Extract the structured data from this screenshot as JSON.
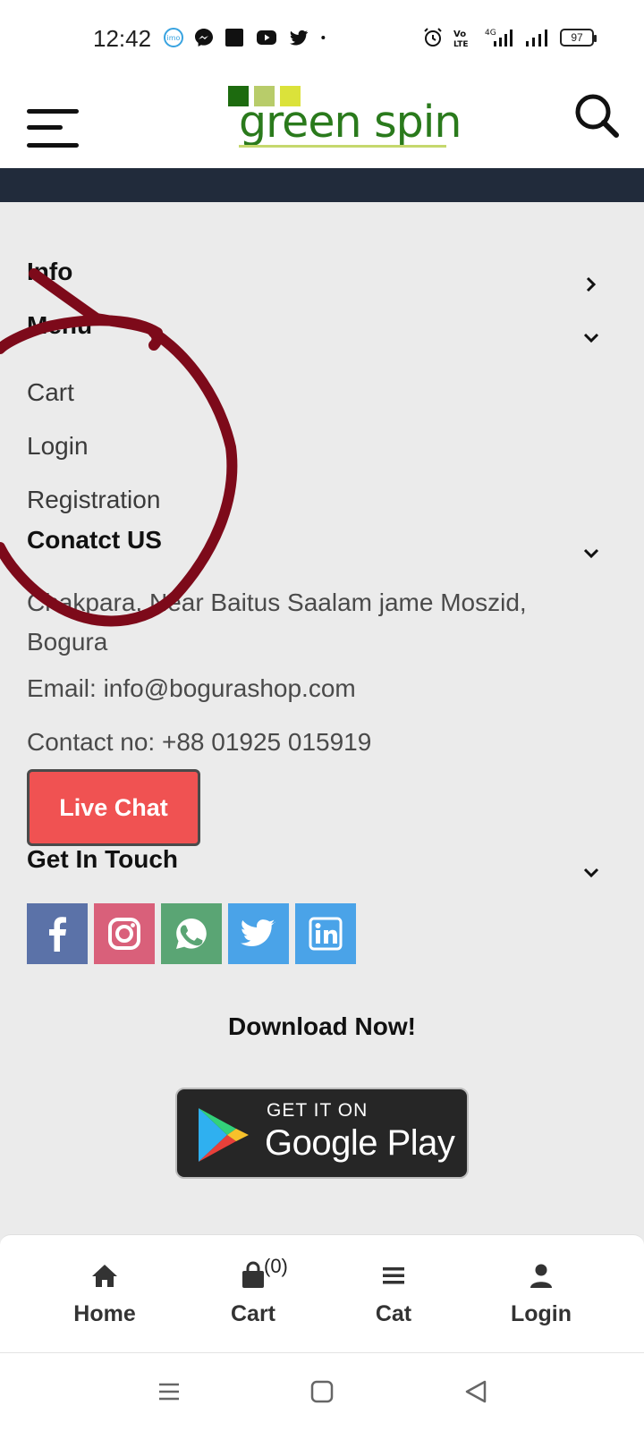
{
  "status_bar": {
    "time": "12:42",
    "battery": "97",
    "icons_left": [
      "imo-icon",
      "messenger-icon",
      "app-square-icon",
      "youtube-icon",
      "twitter-icon",
      "dot-icon"
    ],
    "icons_right": [
      "alarm-icon",
      "volte-icon",
      "signal-4g-icon",
      "signal-icon",
      "battery-icon"
    ]
  },
  "header": {
    "logo_text": "green spin",
    "logo_colors": [
      "#1d6b0f",
      "#b8cc6a",
      "#dbe23a"
    ]
  },
  "footer": {
    "info_title": "Info",
    "menu_title": "Menu",
    "menu_items": [
      "Cart",
      "Login",
      "Registration"
    ],
    "contact_title": "Conatct US",
    "address": "Chakpara, Near Baitus Saalam jame Moszid, Bogura",
    "email": "Email: info@bogurashop.com",
    "phone": "Contact no: +88 01925 015919",
    "live_chat_label": "Live Chat",
    "get_in_touch_title": "Get In Touch",
    "social": [
      {
        "name": "facebook",
        "color": "#5b72a8"
      },
      {
        "name": "instagram",
        "color": "#d9607a"
      },
      {
        "name": "whatsapp",
        "color": "#5aa574"
      },
      {
        "name": "twitter",
        "color": "#4aa3e8"
      },
      {
        "name": "linkedin",
        "color": "#4aa3e8"
      }
    ],
    "download_title": "Download Now!",
    "play_badge": {
      "small": "GET IT ON",
      "big": "Google Play"
    }
  },
  "bottom_nav": {
    "home": "Home",
    "cart": "Cart",
    "cart_count": "(0)",
    "categories": "Cat",
    "login": "Login"
  },
  "annotation": {
    "color": "#7d0a1a"
  }
}
